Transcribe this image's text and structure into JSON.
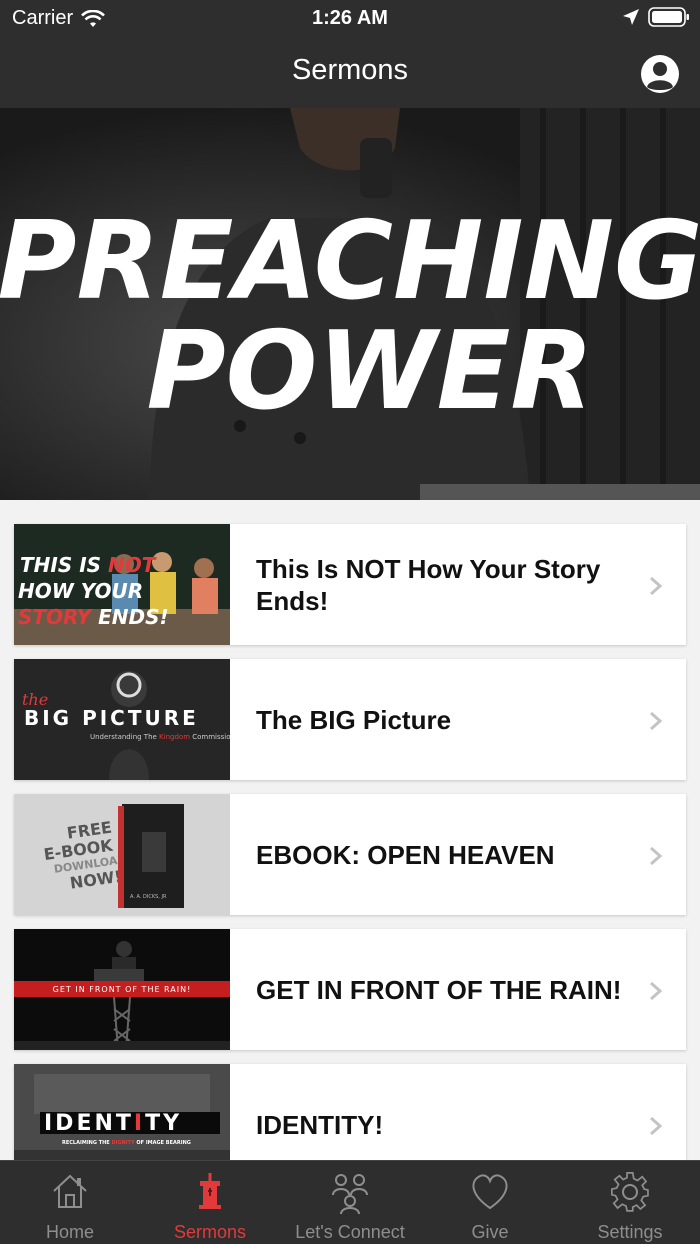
{
  "status": {
    "carrier": "Carrier",
    "time": "1:26 AM"
  },
  "nav": {
    "title": "Sermons"
  },
  "hero": {
    "line1": "PREACHING",
    "line2": "POWER"
  },
  "sermons": [
    {
      "title": "This Is NOT How Your Story Ends!",
      "thumb_text": [
        "THIS IS ",
        "NOT",
        "HOW YOUR",
        "STORY",
        " ENDS!"
      ]
    },
    {
      "title": "The BIG Picture",
      "thumb_text": [
        "the",
        "BIG PICTURE",
        "Understanding The ",
        "Kingdom",
        " Commission"
      ]
    },
    {
      "title": "EBOOK: OPEN HEAVEN",
      "thumb_text": [
        "FREE",
        "E-BOOK",
        "DOWNLOAD",
        "NOW!",
        "A. A. DICKS, JR"
      ]
    },
    {
      "title": "GET IN FRONT OF THE RAIN!",
      "thumb_text": [
        "GET IN FRONT OF THE RAIN!"
      ]
    },
    {
      "title": "IDENTITY!",
      "thumb_text": [
        "IDENT",
        "I",
        "TY",
        "RECLAIMING THE ",
        "DIGNITY",
        " OF IMAGE BEARING"
      ]
    }
  ],
  "tabs": [
    {
      "label": "Home",
      "icon": "home-icon"
    },
    {
      "label": "Sermons",
      "icon": "pulpit-icon"
    },
    {
      "label": "Let's Connect",
      "icon": "people-icon"
    },
    {
      "label": "Give",
      "icon": "heart-icon"
    },
    {
      "label": "Settings",
      "icon": "gear-icon"
    }
  ],
  "colors": {
    "bar": "#2e2e2e",
    "accent": "#e23a3a",
    "inactive": "#8e8e8e"
  }
}
